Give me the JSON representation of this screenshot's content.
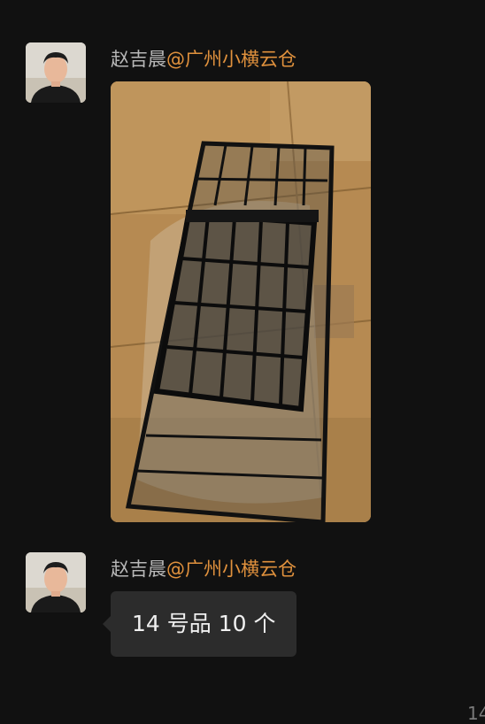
{
  "messages": [
    {
      "sender_name": "赵吉晨",
      "sender_org": "@广州小横云仓",
      "type": "image",
      "image_alt": "black metal wire basket wrapped in plastic on cardboard"
    },
    {
      "sender_name": "赵吉晨",
      "sender_org": "@广州小横云仓",
      "type": "text",
      "text": "14 号品 10 个"
    }
  ],
  "corner_text": "14",
  "colors": {
    "background": "#111111",
    "sender_name": "#b8b8b8",
    "sender_org": "#e0913d",
    "bubble": "#2c2c2c"
  }
}
